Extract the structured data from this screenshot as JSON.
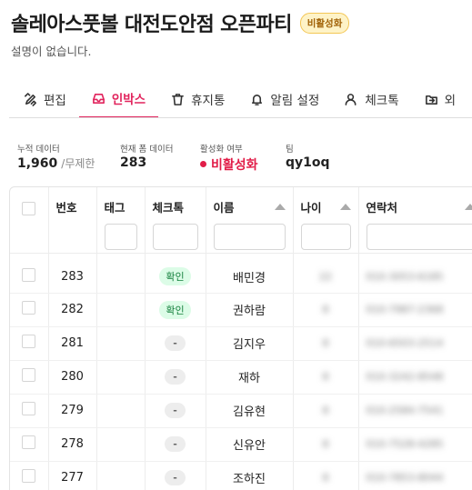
{
  "header": {
    "title": "솔레아스풋볼 대전도안점 오픈파티",
    "badge": "비활성화",
    "description": "설명이 없습니다."
  },
  "tabs": [
    {
      "label": "편집",
      "icon": "edit-icon"
    },
    {
      "label": "인박스",
      "icon": "inbox-icon",
      "active": true
    },
    {
      "label": "휴지통",
      "icon": "trash-icon"
    },
    {
      "label": "알림 설정",
      "icon": "bell-icon"
    },
    {
      "label": "체크톡",
      "icon": "user-icon"
    },
    {
      "label": "외",
      "icon": "export-icon"
    }
  ],
  "stats": {
    "cumulative": {
      "label": "누적 데이터",
      "value": "1,960",
      "sub": "/무제한"
    },
    "current": {
      "label": "현재 폼 데이터",
      "value": "283"
    },
    "active": {
      "label": "활성화 여부",
      "value": "비활성화"
    },
    "team": {
      "label": "팀",
      "value": "qy1oq"
    }
  },
  "table": {
    "columns": [
      "번호",
      "태그",
      "체크톡",
      "이름",
      "나이",
      "연락처"
    ],
    "rows": [
      {
        "no": "283",
        "check": "확인",
        "name": "배민경",
        "age": "22",
        "phone": "010-3053-6185"
      },
      {
        "no": "282",
        "check": "확인",
        "name": "권하람",
        "age": "8",
        "phone": "010-7987-2368"
      },
      {
        "no": "281",
        "check": "-",
        "name": "김지우",
        "age": "8",
        "phone": "010-6503-2514"
      },
      {
        "no": "280",
        "check": "-",
        "name": "재하",
        "age": "8",
        "phone": "010-3242-8548"
      },
      {
        "no": "279",
        "check": "-",
        "name": "김유현",
        "age": "8",
        "phone": "010-2584-7541"
      },
      {
        "no": "278",
        "check": "-",
        "name": "신유안",
        "age": "8",
        "phone": "010-7528-4285"
      },
      {
        "no": "277",
        "check": "-",
        "name": "조하진",
        "age": "8",
        "phone": "010-7853-8044"
      }
    ]
  },
  "colors": {
    "accent": "#e1245d",
    "inactive": "#e11d48",
    "badge_bg": "#fef3c7",
    "confirm_bg": "#dcfce7"
  }
}
